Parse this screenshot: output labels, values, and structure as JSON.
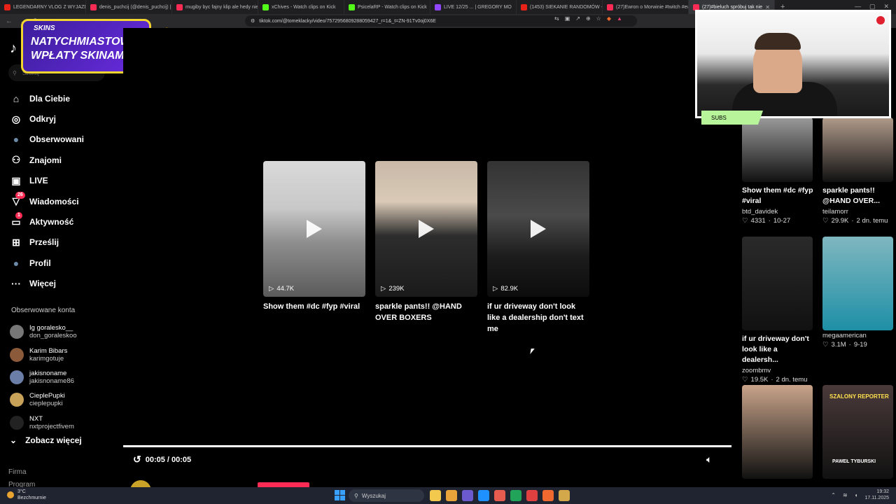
{
  "browser": {
    "tabs": [
      {
        "title": "LEGENDARNY VLOG Z WYJAZDU !!!",
        "color": "#e62117"
      },
      {
        "title": "denis_puchcij (@denis_puchcij) | TikT",
        "color": "#fe2c55"
      },
      {
        "title": "mugiby byc fajny klip ale hedy nie h",
        "color": "#fe2c55"
      },
      {
        "title": "xChives - Watch clips on Kick",
        "color": "#53fc18"
      },
      {
        "title": "PsicelaRP - Watch clips on Kick",
        "color": "#53fc18"
      },
      {
        "title": "LIVE 12/25 ... | GREGORY MO",
        "color": "#9146ff"
      },
      {
        "title": "(1453) SIEKANIE RANDOMÓW - YouT",
        "color": "#e62117"
      },
      {
        "title": "(27)Ewron o Morwinie #twitch #ewr",
        "color": "#fe2c55"
      },
      {
        "title": "(27)#bieluch spróbuj tak nie",
        "color": "#fe2c55",
        "active": true
      }
    ],
    "new_tab": "+",
    "url": "tiktok.com/@tomeklacky/video/7572956809288059427_r=1&_t=ZN-91Tv0oj0X6E"
  },
  "promo": {
    "brand": "SKINS",
    "line1": "NATYCHMIASTOWE",
    "line2": "WPŁATY SKINAMI!"
  },
  "sidebar": {
    "search_placeholder": "Szukaj",
    "nav": [
      {
        "label": "Dla Ciebie",
        "icon": "home-icon",
        "glyph": "⌂"
      },
      {
        "label": "Odkryj",
        "icon": "compass-icon",
        "glyph": "◎"
      },
      {
        "label": "Obserwowani",
        "icon": "following-avatar-icon",
        "glyph": "●"
      },
      {
        "label": "Znajomi",
        "icon": "friends-icon",
        "glyph": "⚇"
      },
      {
        "label": "LIVE",
        "icon": "live-icon",
        "glyph": "▣"
      },
      {
        "label": "Wiadomości",
        "icon": "messages-icon",
        "glyph": "▽",
        "badge": "26"
      },
      {
        "label": "Aktywność",
        "icon": "activity-icon",
        "glyph": "▭",
        "badge": "1"
      },
      {
        "label": "Prześlij",
        "icon": "upload-icon",
        "glyph": "⊞"
      },
      {
        "label": "Profil",
        "icon": "profile-avatar-icon",
        "glyph": "●"
      },
      {
        "label": "Więcej",
        "icon": "more-icon",
        "glyph": "···"
      }
    ],
    "followed_heading": "Obserwowane konta",
    "accounts": [
      {
        "name": "Ig goralesko__",
        "user": "don_goraleskoo",
        "color": "#777"
      },
      {
        "name": "Karim Bibars",
        "user": "karimgotuje",
        "color": "#8a5a3a"
      },
      {
        "name": "jakisnoname",
        "user": "jakisnoname86",
        "color": "#6b7ea8"
      },
      {
        "name": "CieplePupki",
        "user": "cieplepupki",
        "color": "#c9a25a"
      },
      {
        "name": "NXT",
        "user": "nxtprojectfivem",
        "color": "#222"
      }
    ],
    "see_more": "Zobacz więcej",
    "footer": [
      "Firma",
      "Program"
    ]
  },
  "player": {
    "cards": [
      {
        "views": "44.7K",
        "title": "Show them #dc #fyp #viral"
      },
      {
        "views": "239K",
        "title": "sparkle pants!! @HAND OVER BOXERS"
      },
      {
        "views": "82.9K",
        "title": "if ur driveway don't look like a dealership don't text me"
      }
    ],
    "time": "00:05 / 00:05",
    "progress": 1.0,
    "author": "tomeklacky"
  },
  "related": [
    {
      "title": "Show them #dc #fyp #viral",
      "user": "btd_davidek",
      "likes": "4331",
      "date": "10-27",
      "color": "#9a9a9a"
    },
    {
      "title": "sparkle pants!! @HAND OVER...",
      "user": "teilamorr",
      "likes": "29.9K",
      "date": "2 dn. temu",
      "color": "#b09a8a"
    },
    {
      "title": "if ur driveway don't look like a dealersh...",
      "user": "zoombmv",
      "likes": "19.5K",
      "date": "2 dn. temu",
      "color": "#2a2a2a"
    },
    {
      "title": "",
      "user": "megaamerican",
      "likes": "3.1M",
      "date": "9-19",
      "color": "#3fa8b8"
    },
    {
      "title": "",
      "user": "",
      "likes": "",
      "date": "",
      "color": "#c9a48a"
    },
    {
      "title": "",
      "user": "",
      "likes": "",
      "date": "",
      "color": "#4a3a3a"
    }
  ],
  "related_labels": {
    "reporter_line1": "SZALONY REPORTER",
    "reporter_line2": "PAWEŁ TYBURSKI"
  },
  "webcam": {
    "subs_label": "SUBS"
  },
  "taskbar": {
    "weather_temp": "3°C",
    "weather_desc": "Bezchmurnie",
    "search": "Wyszukaj",
    "time": "19:32",
    "date": "17.11.2025",
    "apps": [
      "#f2c94c",
      "#e8a33a",
      "#6a5acd",
      "#1e90ff",
      "#e65c4f",
      "#22a35a",
      "#e04040",
      "#f06a30",
      "#d3a84b"
    ]
  }
}
